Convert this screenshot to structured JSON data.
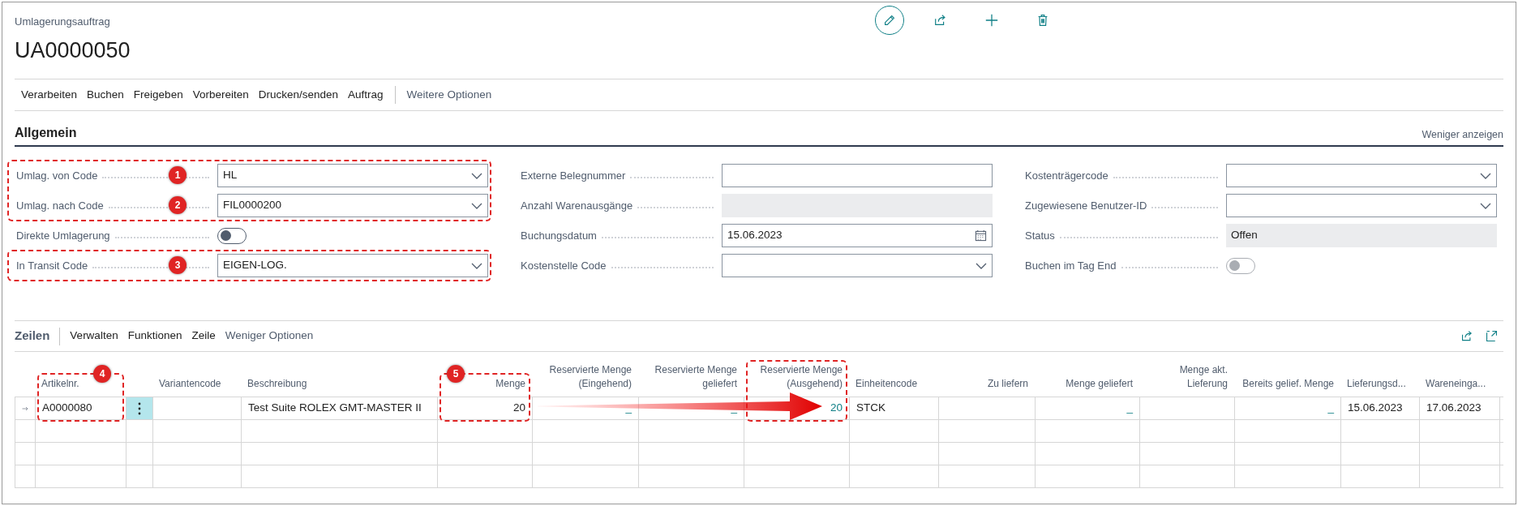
{
  "header": {
    "caption": "Umlagerungsauftrag",
    "title": "UA0000050"
  },
  "header_actions": [
    {
      "kind": "edit"
    },
    {
      "kind": "share"
    },
    {
      "kind": "add"
    },
    {
      "kind": "delete"
    }
  ],
  "action_bar": {
    "items": [
      "Verarbeiten",
      "Buchen",
      "Freigeben",
      "Vorbereiten",
      "Drucken/senden",
      "Auftrag"
    ],
    "more": "Weitere Optionen"
  },
  "section": {
    "title": "Allgemein",
    "toggle": "Weniger anzeigen"
  },
  "form_columns": [
    {
      "fields": [
        {
          "label": "Umlag. von Code",
          "kind": "dropdown",
          "value": "HL",
          "highlighted": true,
          "badge": "1"
        },
        {
          "label": "Umlag. nach Code",
          "kind": "dropdown",
          "value": "FIL0000200",
          "highlighted": true,
          "badge": "2"
        },
        {
          "label": "Direkte Umlagerung",
          "kind": "toggle",
          "on": false,
          "disabled": false,
          "highlighted": false
        },
        {
          "label": "In Transit Code",
          "kind": "dropdown",
          "value": "EIGEN-LOG.",
          "highlighted": true,
          "badge": "3"
        }
      ]
    },
    {
      "fields": [
        {
          "label": "Externe Belegnummer",
          "kind": "text",
          "highlighted": false
        },
        {
          "label": "Anzahl Warenausgänge",
          "kind": "readonly",
          "highlighted": false
        },
        {
          "label": "Buchungsdatum",
          "kind": "date",
          "value": "15.06.2023",
          "highlighted": false
        },
        {
          "label": "Kostenstelle Code",
          "kind": "dropdown",
          "highlighted": false
        }
      ]
    },
    {
      "fields": [
        {
          "label": "Kostenträgercode",
          "kind": "dropdown",
          "highlighted": false
        },
        {
          "label": "Zugewiesene Benutzer-ID",
          "kind": "dropdown",
          "highlighted": false
        },
        {
          "label": "Status",
          "kind": "readonly",
          "value": "Offen",
          "highlighted": false
        },
        {
          "label": "Buchen im Tag End",
          "kind": "toggle",
          "on": false,
          "disabled": true,
          "highlighted": false
        }
      ]
    }
  ],
  "lines": {
    "callout_arrow": true,
    "title": "Zeilen",
    "actions": [
      "Verwalten",
      "Funktionen",
      "Zeile"
    ],
    "less": "Weniger Optionen",
    "tools": [
      {
        "kind": "share"
      },
      {
        "kind": "expand"
      }
    ],
    "columns": [
      {
        "kind": "indicator"
      },
      {
        "kind": "text",
        "label": "Artikelnr.",
        "highlighted": true,
        "badge": "4"
      },
      {
        "kind": "menu"
      },
      {
        "kind": "text",
        "label": "Variantencode",
        "highlighted": false
      },
      {
        "kind": "text",
        "label": "Beschreibung",
        "highlighted": false
      },
      {
        "kind": "number",
        "label": "Menge",
        "highlighted": true,
        "badge": "5"
      },
      {
        "kind": "number",
        "label": "Reservierte Menge (Eingehend)",
        "highlighted": false
      },
      {
        "kind": "number",
        "label": "Reservierte Menge geliefert",
        "highlighted": false
      },
      {
        "kind": "number",
        "label": "Reservierte Menge (Ausgehend)",
        "highlighted": true
      },
      {
        "kind": "text",
        "label": "Einheitencode",
        "highlighted": false
      },
      {
        "kind": "number",
        "label": "Zu liefern",
        "highlighted": false
      },
      {
        "kind": "number",
        "label": "Menge geliefert",
        "highlighted": false
      },
      {
        "kind": "number",
        "label": "Menge akt. Lieferung",
        "highlighted": false
      },
      {
        "kind": "number",
        "label": "Bereits gelief. Menge",
        "highlighted": false
      },
      {
        "kind": "text",
        "label": "Lieferungsd...",
        "highlighted": false
      },
      {
        "kind": "text",
        "label": "Wareneinga...",
        "highlighted": false
      }
    ],
    "rows": [
      {
        "current": true,
        "cells": [
          "",
          "A0000080",
          "",
          "",
          "Test Suite ROLEX GMT-MASTER II",
          "20",
          {
            "text": "_",
            "link": true
          },
          {
            "text": "_",
            "link": true
          },
          {
            "text": "20",
            "link": true
          },
          "STCK",
          "",
          {
            "text": "_",
            "link": true
          },
          "",
          {
            "text": "_",
            "link": true
          },
          "15.06.2023",
          "17.06.2023"
        ]
      }
    ]
  }
}
